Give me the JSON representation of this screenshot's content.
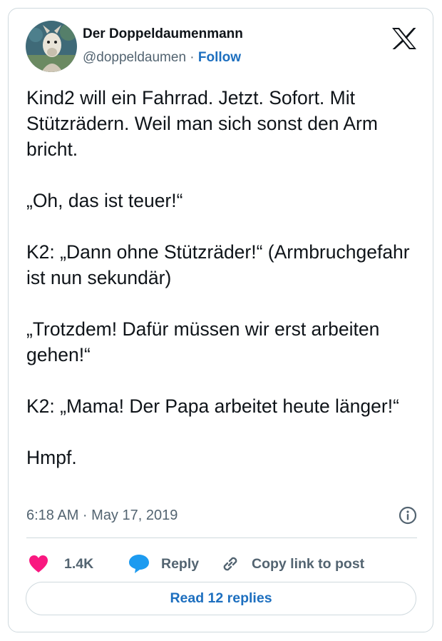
{
  "author": {
    "display_name": "Der Doppeldaumenmann",
    "handle": "@doppeldaumen",
    "separator": "·",
    "follow_label": "Follow"
  },
  "tweet": {
    "paragraphs": [
      "Kind2 will ein Fahrrad. Jetzt. Sofort. Mit Stützrädern. Weil man sich sonst den Arm bricht.",
      "„Oh, das ist teuer!“",
      "K2: „Dann ohne Stützräder!“ (Armbruchgefahr ist nun sekundär)",
      "„Trotzdem! Dafür müssen wir erst arbeiten gehen!“",
      "K2: „Mama! Der Papa arbeitet heute länger!“",
      "Hmpf."
    ],
    "timestamp": "6:18 AM · May 17, 2019"
  },
  "actions": {
    "like_count": "1.4K",
    "reply_label": "Reply",
    "copy_link_label": "Copy link to post"
  },
  "read_replies_label": "Read 12 replies",
  "colors": {
    "like": "#f91880",
    "reply": "#1d9bf0",
    "link": "#1d6fbf",
    "muted": "#536471",
    "border": "#cfd9de"
  },
  "icons": {
    "platform": "x-logo-icon",
    "like": "heart-icon",
    "reply": "speech-bubble-icon",
    "copy_link": "link-icon",
    "info": "info-icon"
  }
}
